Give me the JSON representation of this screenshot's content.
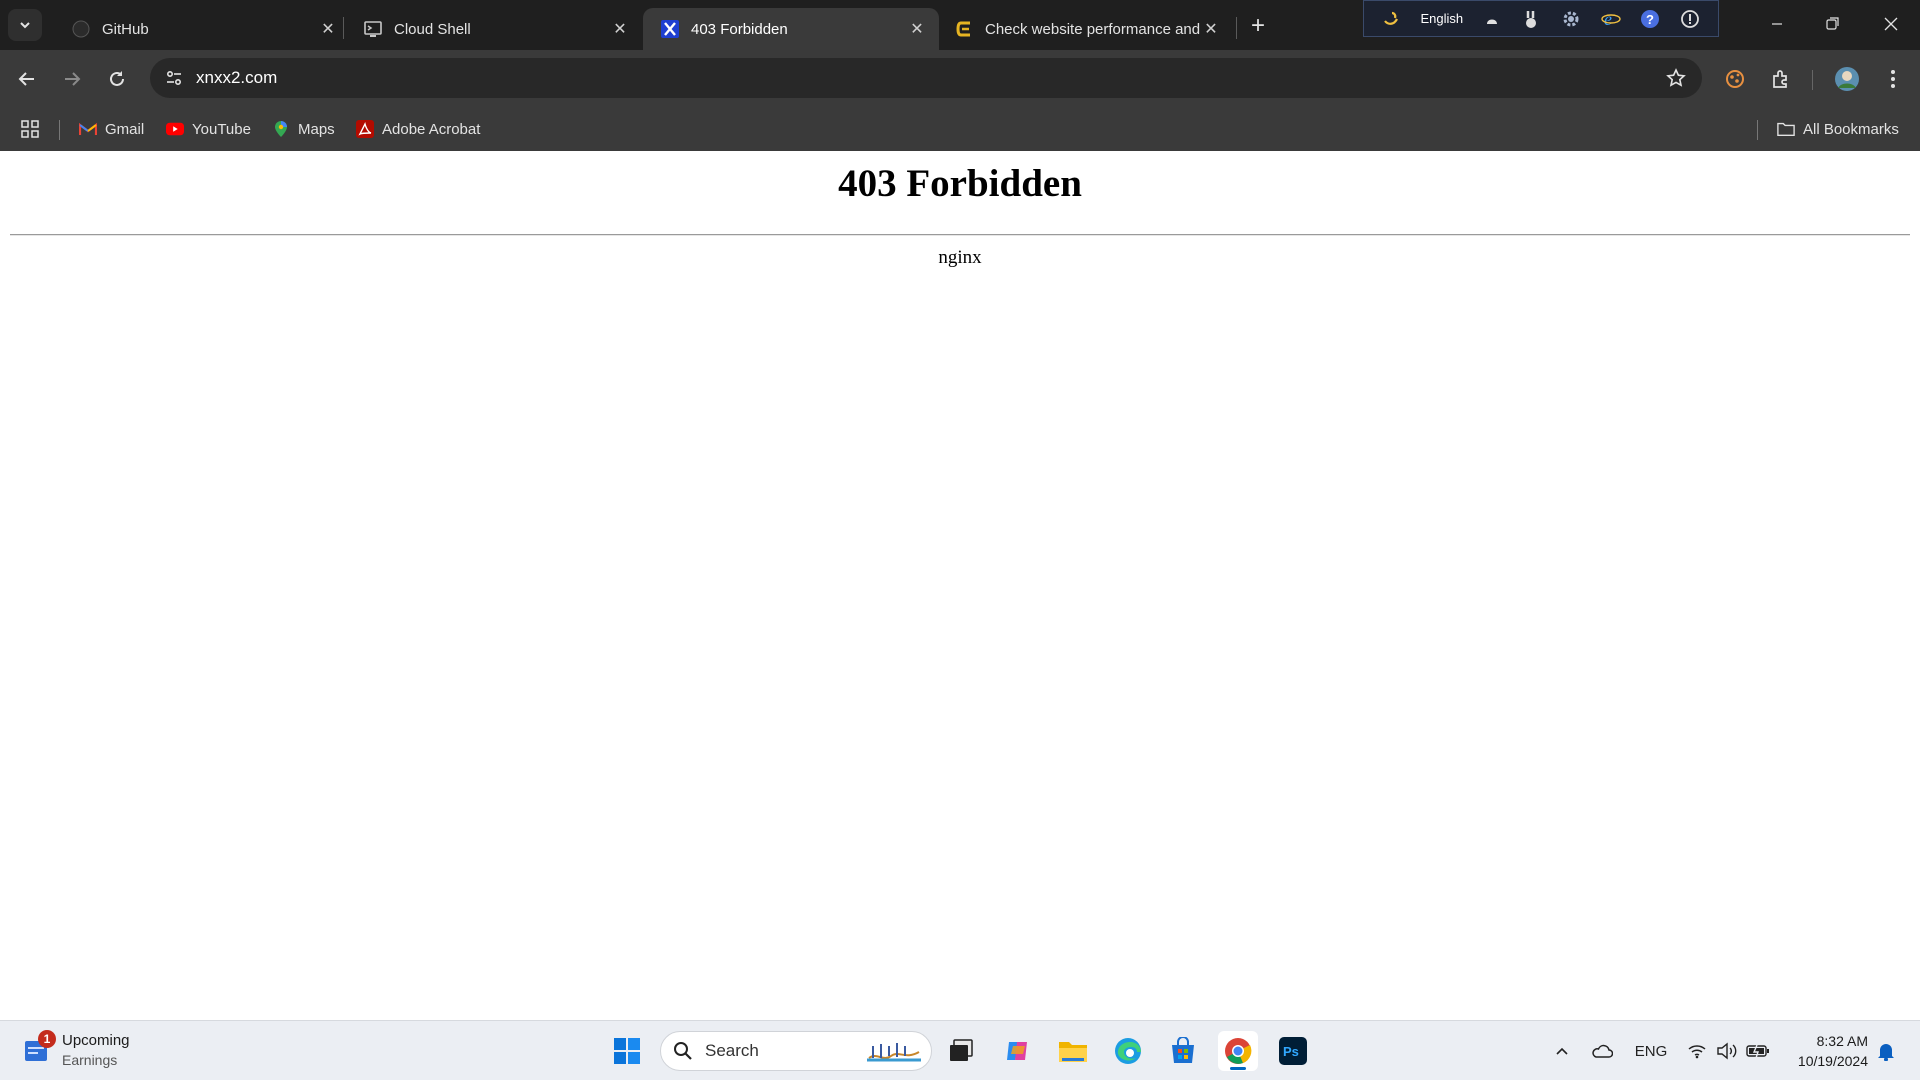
{
  "tabs": [
    {
      "title": "GitHub",
      "favicon": "github-icon",
      "active": false
    },
    {
      "title": "Cloud Shell",
      "favicon": "cloud-shell-icon",
      "active": false
    },
    {
      "title": "403 Forbidden",
      "favicon": "x-favicon-icon",
      "active": true
    },
    {
      "title": "Check website performance and",
      "favicon": "performance-site-icon",
      "active": false
    }
  ],
  "language_bar": {
    "language": "English"
  },
  "address_bar": {
    "url": "xnxx2.com"
  },
  "bookmarks": [
    {
      "label": "Gmail",
      "icon": "gmail-icon"
    },
    {
      "label": "YouTube",
      "icon": "youtube-icon"
    },
    {
      "label": "Maps",
      "icon": "maps-icon"
    },
    {
      "label": "Adobe Acrobat",
      "icon": "adobe-acrobat-icon"
    }
  ],
  "all_bookmarks_label": "All Bookmarks",
  "page": {
    "heading": "403 Forbidden",
    "server": "nginx"
  },
  "taskbar": {
    "widget": {
      "badge": "1",
      "title": "Upcoming",
      "subtitle": "Earnings"
    },
    "search_placeholder": "Search",
    "language": "ENG",
    "time": "8:32 AM",
    "date": "10/19/2024"
  },
  "colors": {
    "tab_strip": "#1f1f1f",
    "toolbar": "#3a3a3a",
    "omnibox": "#282828",
    "taskbar": "#ebeef3",
    "accent": "#0067c0"
  }
}
